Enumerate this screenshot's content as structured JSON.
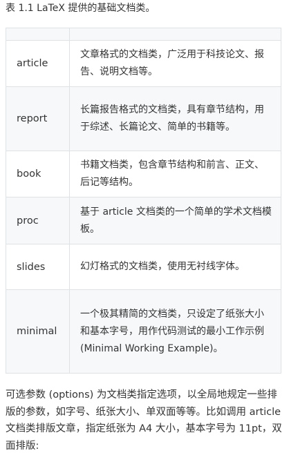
{
  "caption": "表 1.1 LaTeX 提供的基础文档类。",
  "table": {
    "headers": [
      "",
      ""
    ],
    "rows": [
      {
        "name": "article",
        "desc": "文章格式的文档类，广泛用于科技论文、报告、说明文档等。"
      },
      {
        "name": "report",
        "desc": "长篇报告格式的文档类，具有章节结构，用于综述、长篇论文、简单的书籍等。"
      },
      {
        "name": "book",
        "desc": "书籍文档类，包含章节结构和前言、正文、后记等结构。"
      },
      {
        "name": "proc",
        "desc": "基于 article 文档类的一个简单的学术文档模板。"
      },
      {
        "name": "slides",
        "desc": "幻灯格式的文档类，使用无衬线字体。"
      },
      {
        "name": "minimal",
        "desc": "一个极其精简的文档类，只设定了纸张大小和基本字号，用作代码测试的最小工作示例(Minimal Working Example)。"
      }
    ]
  },
  "paragraph": "可选参数 (options) 为文档类指定选项，以全局地规定一些排版的参数，如字号、纸张大小、单双面等等。比如调用 article 文档类排版文章，指定纸张为 A4 大小，基本字号为 11pt，双面排版:",
  "colors": {
    "text": "#333333",
    "border": "#dfe2e5",
    "stripe": "#f6f8fa"
  }
}
